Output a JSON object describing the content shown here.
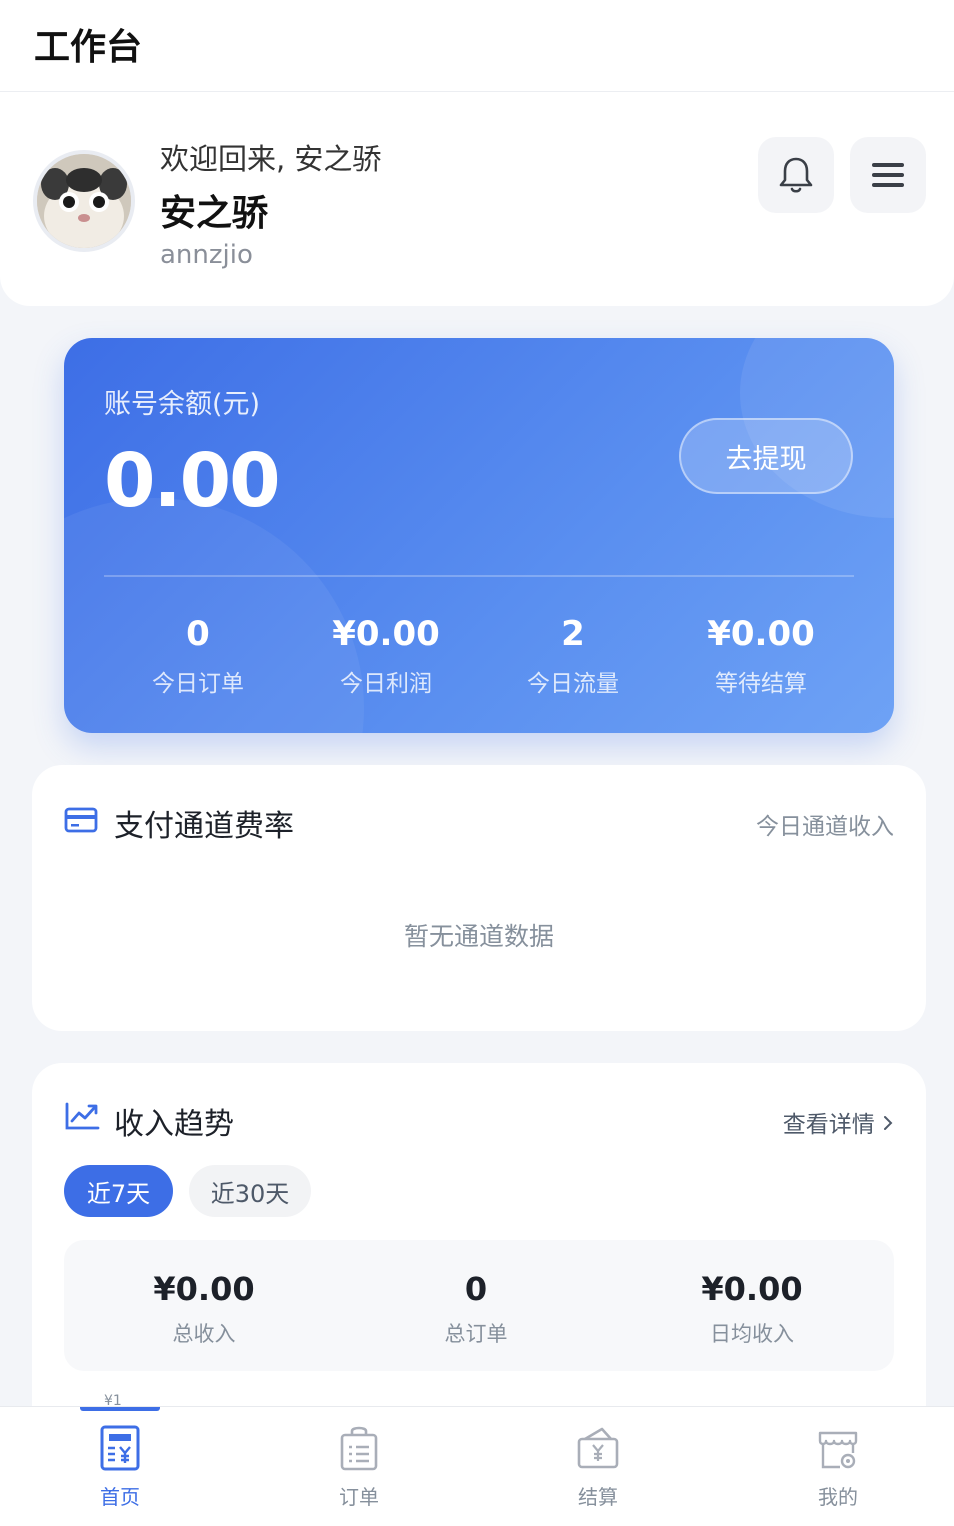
{
  "header": {
    "title": "工作台"
  },
  "profile": {
    "welcome": "欢迎回来, 安之骄",
    "name": "安之骄",
    "username": "annzjio"
  },
  "balance": {
    "label": "账号余额(元)",
    "value": "0.00",
    "withdraw_label": "去提现",
    "stats": [
      {
        "value": "0",
        "label": "今日订单"
      },
      {
        "value": "¥0.00",
        "label": "今日利润"
      },
      {
        "value": "2",
        "label": "今日流量"
      },
      {
        "value": "¥0.00",
        "label": "等待结算"
      }
    ]
  },
  "payment_channels": {
    "title": "支付通道费率",
    "right_label": "今日通道收入",
    "empty_text": "暂无通道数据"
  },
  "income_trend": {
    "title": "收入趋势",
    "detail_link": "查看详情",
    "ranges": [
      "近7天",
      "近30天"
    ],
    "active_range": "近7天",
    "summary": [
      {
        "value": "¥0.00",
        "label": "总收入"
      },
      {
        "value": "0",
        "label": "总订单"
      },
      {
        "value": "¥0.00",
        "label": "日均收入"
      }
    ],
    "chart_tick": "¥1"
  },
  "nav": {
    "items": [
      {
        "label": "首页",
        "icon": "home-receipt-icon",
        "active": true
      },
      {
        "label": "订单",
        "icon": "order-bag-icon",
        "active": false
      },
      {
        "label": "结算",
        "icon": "settlement-wallet-icon",
        "active": false
      },
      {
        "label": "我的",
        "icon": "store-settings-icon",
        "active": false
      }
    ]
  },
  "colors": {
    "accent": "#3d6ee6",
    "card_gradient_start": "#3d6ee6",
    "card_gradient_end": "#6ea2f5",
    "background": "#f3f5f9"
  }
}
